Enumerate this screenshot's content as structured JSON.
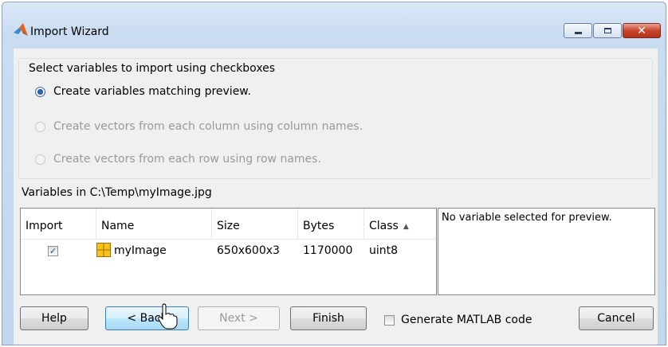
{
  "window": {
    "title": "Import Wizard",
    "controls": {
      "minimize": "minimize",
      "maximize": "maximize",
      "close": "✕"
    }
  },
  "options_group": {
    "legend": "Select variables to import using checkboxes",
    "options": [
      {
        "label": "Create variables matching preview.",
        "selected": true,
        "enabled": true
      },
      {
        "label": "Create vectors from each column using column names.",
        "selected": false,
        "enabled": false
      },
      {
        "label": "Create vectors from each row using row names.",
        "selected": false,
        "enabled": false
      }
    ]
  },
  "variables": {
    "label": "Variables in C:\\Temp\\myImage.jpg",
    "columns": [
      "Import",
      "Name",
      "Size",
      "Bytes",
      "Class"
    ],
    "sort_indicator": "▲",
    "rows": [
      {
        "import": "✓",
        "name": "myImage",
        "size": "650x600x3",
        "bytes": "1170000",
        "class": "uint8"
      }
    ]
  },
  "preview": {
    "text": "No variable selected for preview."
  },
  "buttons": {
    "help": "Help",
    "back": "< Back",
    "next": "Next >",
    "finish": "Finish",
    "generate_code": "Generate MATLAB code",
    "cancel": "Cancel"
  },
  "colors": {
    "accent": "#3c7fb1",
    "title_bar": "#c9dcf2",
    "close_button": "#c8452d"
  }
}
